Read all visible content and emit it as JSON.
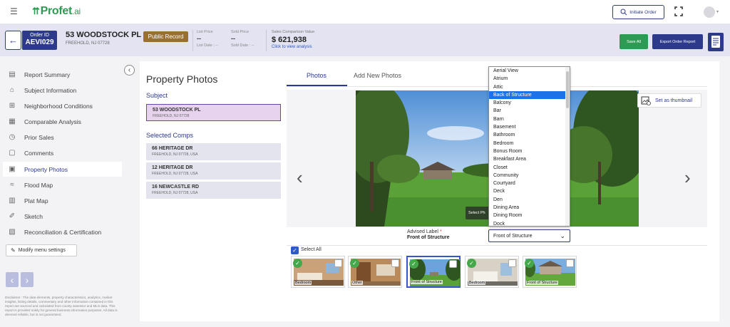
{
  "topbar": {
    "logo": "Profet",
    "logo_suffix": ".ai",
    "initiate_label": "Initiate Order"
  },
  "order": {
    "id_label": "Order ID",
    "id": "AEVI029",
    "address": "53 WOODSTOCK PL",
    "city": "FREEHOLD, NJ 07728",
    "badge": "Public Record",
    "list_price_label": "List Price",
    "list_price": "--",
    "list_date": "List Date : --",
    "sold_price_label": "Sold Price",
    "sold_price": "--",
    "sold_date": "Sold Date : --",
    "scv_label": "Sales Comparison Value",
    "scv_value": "$ 621,938",
    "scv_link": "Click to view analysis",
    "save_all": "Save All",
    "export": "Export Order Report"
  },
  "sidebar": {
    "items": [
      {
        "label": "Report Summary",
        "icon": "report-icon"
      },
      {
        "label": "Subject Information",
        "icon": "home-icon"
      },
      {
        "label": "Neighborhood Conditions",
        "icon": "neighborhood-icon"
      },
      {
        "label": "Comparable Analysis",
        "icon": "chart-icon"
      },
      {
        "label": "Prior Sales",
        "icon": "history-icon"
      },
      {
        "label": "Comments",
        "icon": "comment-icon"
      },
      {
        "label": "Property Photos",
        "icon": "photo-icon"
      },
      {
        "label": "Flood Map",
        "icon": "flood-icon"
      },
      {
        "label": "Plat Map",
        "icon": "map-icon"
      },
      {
        "label": "Sketch",
        "icon": "sketch-icon"
      },
      {
        "label": "Reconciliation & Certification",
        "icon": "certificate-icon"
      }
    ],
    "modify_label": "Modify menu settings",
    "disclaimer": "Disclaimer : The data elements, property characteristics, analytics, market insights, listing details, commentary and other information contained in this report are sourced and calculated from county assessor and MLS data. This report is provided solely for general business information purposes. All data is deemed reliable, but is not guaranteed."
  },
  "photos": {
    "title": "Property Photos",
    "subject_label": "Subject",
    "subject": {
      "name": "53 WOODSTOCK PL",
      "city": "FREEHOLD, NJ 07728"
    },
    "comps_label": "Selected Comps",
    "comps": [
      {
        "name": "66 HERITAGE DR",
        "city": "FREEHOLD, NJ 07728, USA"
      },
      {
        "name": "12 HERITAGE DR",
        "city": "FREEHOLD, NJ 07728, USA"
      },
      {
        "name": "16 NEWCASTLE RD",
        "city": "FREEHOLD, NJ 07728, USA"
      }
    ],
    "tabs": [
      "Photos",
      "Add New Photos"
    ],
    "set_thumbnail": "Set as thumbnail",
    "select_photo": "Select Ph",
    "advised_label": "Advised Label",
    "advised_value": "Front of Structure",
    "select_value": "Front of Structure",
    "select_all": "Select All",
    "dropdown_options": [
      "Aerial View",
      "Atrium",
      "Attic",
      "Back of Structure",
      "Balcony",
      "Bar",
      "Barn",
      "Basement",
      "Bathroom",
      "Bedroom",
      "Bonus Room",
      "Breakfast Area",
      "Closet",
      "Community",
      "Courtyard",
      "Deck",
      "Den",
      "Dining Area",
      "Dining Room",
      "Dock"
    ],
    "dropdown_selected": "Back of Structure",
    "thumbnails": [
      "Bedroom",
      "Other",
      "Front of Structure",
      "Bedroom",
      "Front of Structure"
    ]
  }
}
